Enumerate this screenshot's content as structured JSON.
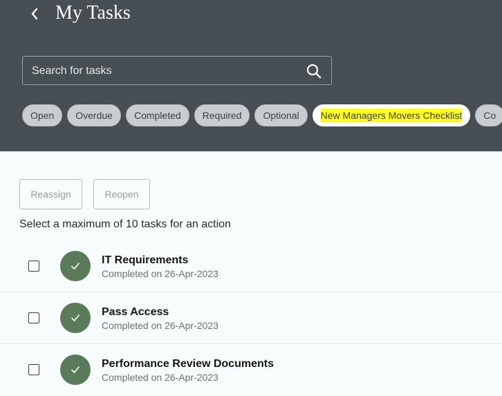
{
  "header": {
    "title": "My Tasks",
    "back_icon": "chevron-left-icon",
    "search": {
      "placeholder": "Search for tasks",
      "value": "",
      "icon": "search-icon"
    },
    "filters": [
      {
        "label": "Open",
        "selected": false
      },
      {
        "label": "Overdue",
        "selected": false
      },
      {
        "label": "Completed",
        "selected": false
      },
      {
        "label": "Required",
        "selected": false
      },
      {
        "label": "Optional",
        "selected": false
      },
      {
        "label": "New Managers Movers Checklist",
        "selected": true
      },
      {
        "label": "Co",
        "selected": false
      }
    ]
  },
  "actions": {
    "reassign_label": "Reassign",
    "reopen_label": "Reopen",
    "hint": "Select a maximum of 10 tasks for an action"
  },
  "tasks": [
    {
      "title": "IT Requirements",
      "status": "Completed on 26-Apr-2023",
      "icon": "checkmark-icon"
    },
    {
      "title": "Pass Access",
      "status": "Completed on 26-Apr-2023",
      "icon": "checkmark-icon"
    },
    {
      "title": "Performance Review Documents",
      "status": "Completed on 26-Apr-2023",
      "icon": "checkmark-icon"
    }
  ],
  "colors": {
    "header_bg": "#474f55",
    "page_bg": "#f7fcfc",
    "completed_green": "#5b7a59",
    "highlight": "#ffff20"
  }
}
